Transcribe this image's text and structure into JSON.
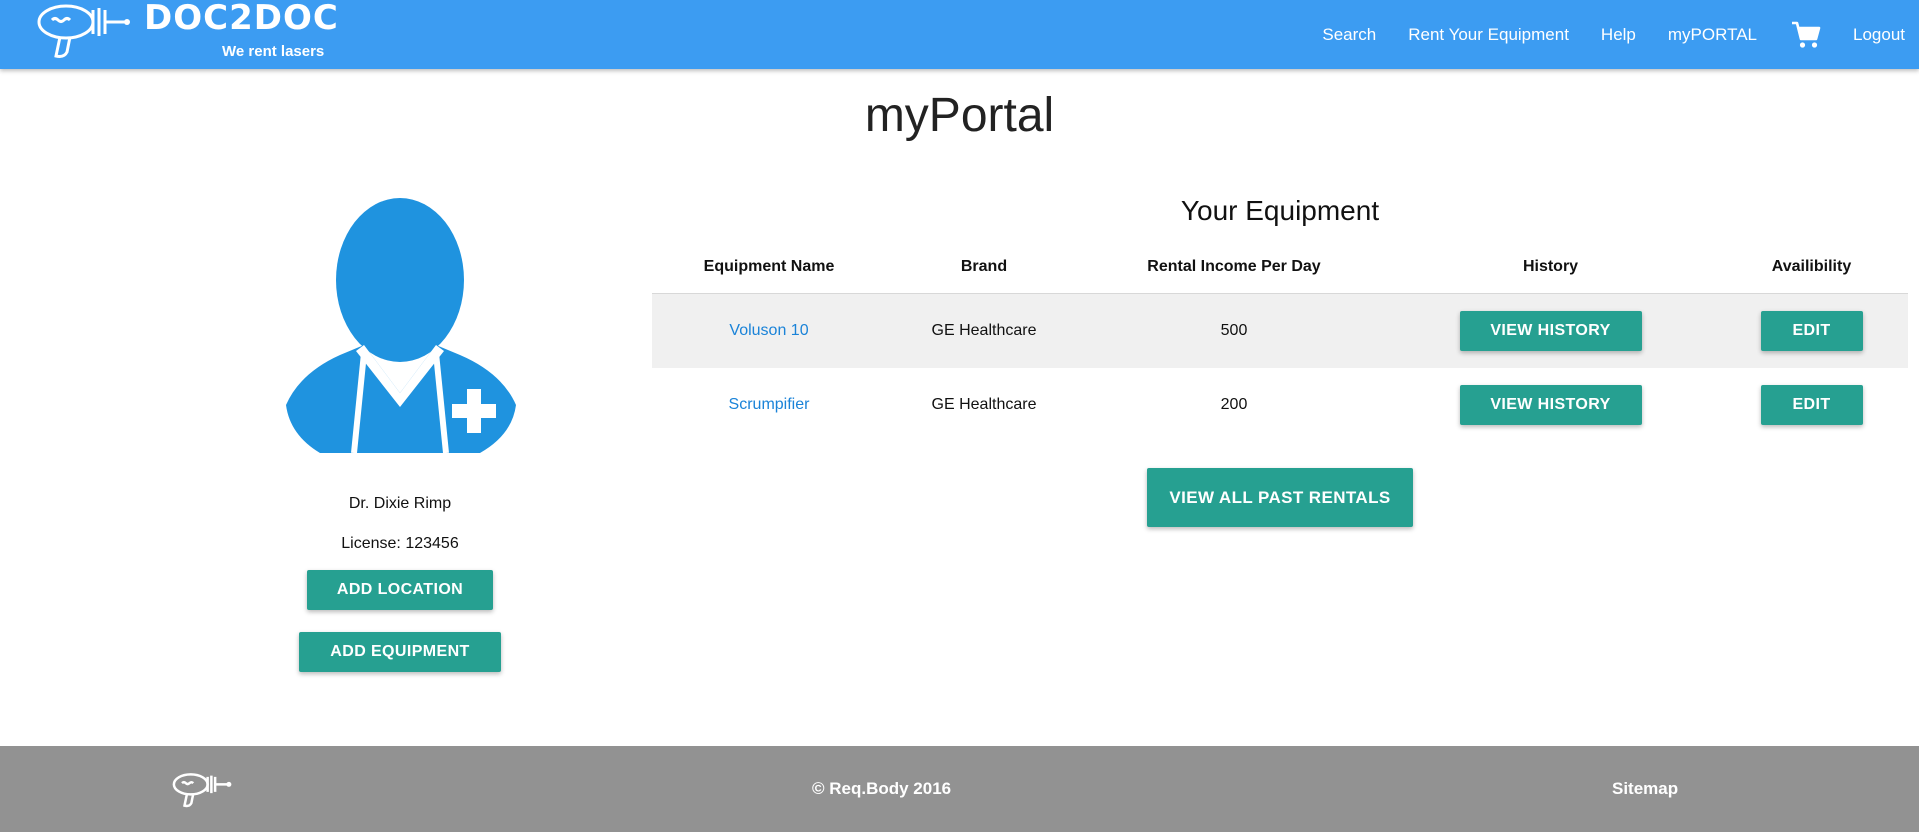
{
  "header": {
    "brand_name": "DOC2DOC",
    "brand_tagline": "We rent lasers",
    "nav": [
      {
        "label": "Search"
      },
      {
        "label": "Rent Your Equipment"
      },
      {
        "label": "Help"
      },
      {
        "label": "myPORTAL"
      },
      {
        "label": "Logout"
      }
    ],
    "cart_icon": "shopping-cart-icon"
  },
  "page": {
    "title": "myPortal"
  },
  "profile": {
    "avatar_icon": "doctor-avatar-icon",
    "name": "Dr. Dixie Rimp",
    "license": "License: 123456",
    "add_location_label": "ADD LOCATION",
    "add_equipment_label": "ADD EQUIPMENT"
  },
  "equipment": {
    "title": "Your Equipment",
    "columns": [
      "Equipment Name",
      "Brand",
      "Rental Income Per Day",
      "History",
      "Availibility"
    ],
    "rows": [
      {
        "name": "Voluson 10",
        "brand": "GE Healthcare",
        "income": "500",
        "history_label": "VIEW HISTORY",
        "edit_label": "EDIT"
      },
      {
        "name": "Scrumpifier",
        "brand": "GE Healthcare",
        "income": "200",
        "history_label": "VIEW HISTORY",
        "edit_label": "EDIT"
      }
    ],
    "view_all_label": "VIEW ALL PAST RENTALS"
  },
  "footer": {
    "copyright": "© Req.Body 2016",
    "sitemap": "Sitemap"
  },
  "colors": {
    "header": "#3c9cf2",
    "button": "#26a091",
    "link": "#1a83d8",
    "footer": "#929292",
    "avatar": "#1f93df"
  }
}
